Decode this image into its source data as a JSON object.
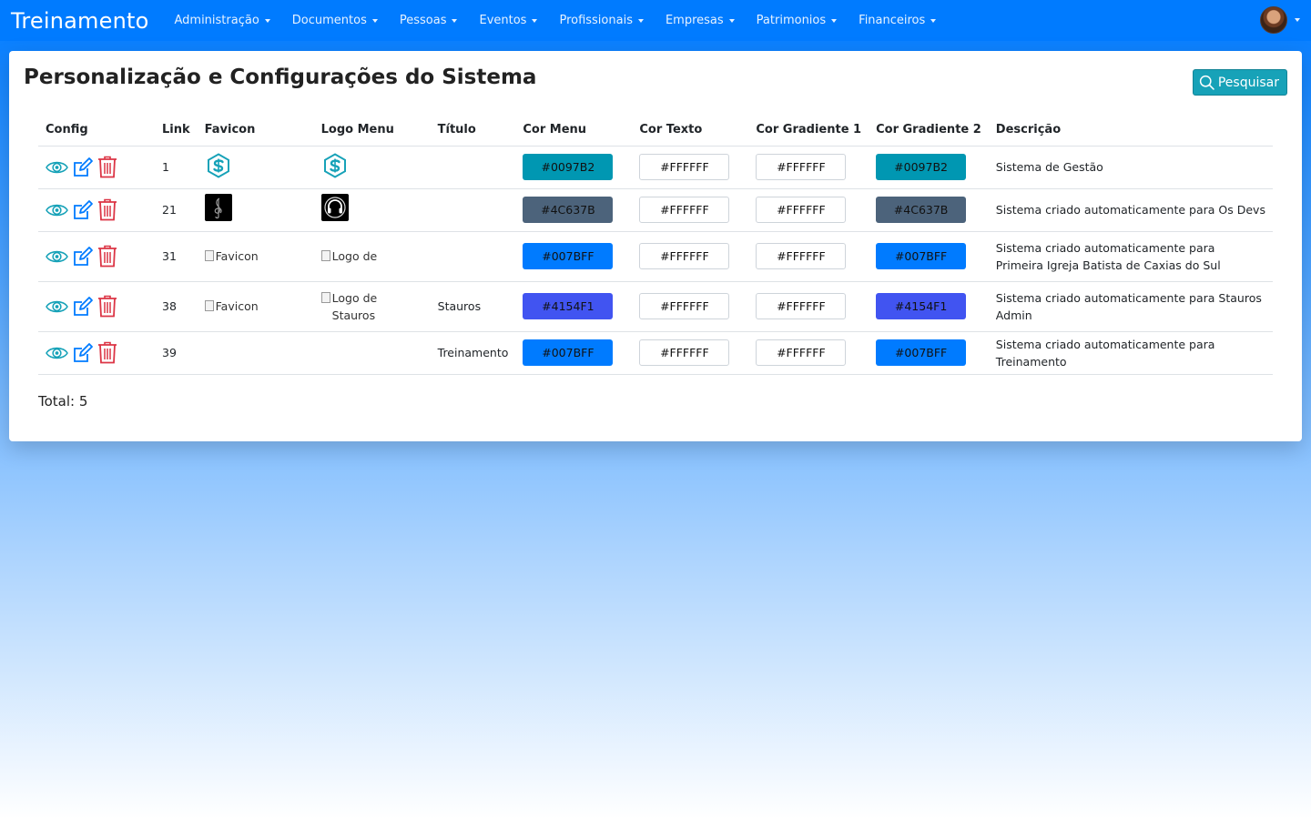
{
  "navbar": {
    "brand": "Treinamento",
    "menu": [
      {
        "label": "Administração"
      },
      {
        "label": "Documentos"
      },
      {
        "label": "Pessoas"
      },
      {
        "label": "Eventos"
      },
      {
        "label": "Profissionais"
      },
      {
        "label": "Empresas"
      },
      {
        "label": "Patrimonios"
      },
      {
        "label": "Financeiros"
      }
    ],
    "user_icon": "avatar"
  },
  "page": {
    "title": "Personalização e Configurações do Sistema",
    "search_label": "Pesquisar",
    "search_icon": "search-icon"
  },
  "table": {
    "headers": {
      "config": "Config",
      "link": "Link",
      "favicon": "Favicon",
      "logo": "Logo Menu",
      "titulo": "Título",
      "cor_menu": "Cor Menu",
      "cor_texto": "Cor Texto",
      "cor_grad1": "Cor Gradiente 1",
      "cor_grad2": "Cor Gradiente 2",
      "descricao": "Descrição"
    },
    "action_icons": [
      "eye-icon",
      "edit-icon",
      "trash-icon"
    ],
    "rows": [
      {
        "link": "1",
        "favicon_type": "s-logo",
        "favicon_alt": "",
        "logo_type": "s-logo",
        "logo_alt": "",
        "titulo": "",
        "cor_menu": "#0097B2",
        "cor_texto": "#FFFFFF",
        "cor_grad1": "#FFFFFF",
        "cor_grad2": "#0097B2",
        "descricao": "Sistema de Gestão"
      },
      {
        "link": "21",
        "favicon_type": "music-note",
        "favicon_alt": "",
        "logo_type": "headphones",
        "logo_alt": "",
        "titulo": "",
        "cor_menu": "#4C637B",
        "cor_texto": "#FFFFFF",
        "cor_grad1": "#FFFFFF",
        "cor_grad2": "#4C637B",
        "descricao": "Sistema criado automaticamente para Os Devs"
      },
      {
        "link": "31",
        "favicon_type": "broken",
        "favicon_alt": "Favicon",
        "logo_type": "broken",
        "logo_alt": "Logo de",
        "titulo": "",
        "cor_menu": "#007BFF",
        "cor_texto": "#FFFFFF",
        "cor_grad1": "#FFFFFF",
        "cor_grad2": "#007BFF",
        "descricao": "Sistema criado automaticamente para Primeira Igreja Batista de Caxias do Sul"
      },
      {
        "link": "38",
        "favicon_type": "broken",
        "favicon_alt": "Favicon",
        "logo_type": "broken",
        "logo_alt": "Logo de Stauros",
        "titulo": "Stauros",
        "cor_menu": "#4154F1",
        "cor_texto": "#FFFFFF",
        "cor_grad1": "#FFFFFF",
        "cor_grad2": "#4154F1",
        "descricao": "Sistema criado automaticamente para Stauros Admin"
      },
      {
        "link": "39",
        "favicon_type": "none",
        "favicon_alt": "",
        "logo_type": "none",
        "logo_alt": "",
        "titulo": "Treinamento",
        "cor_menu": "#007BFF",
        "cor_texto": "#FFFFFF",
        "cor_grad1": "#FFFFFF",
        "cor_grad2": "#007BFF",
        "descricao": "Sistema criado automaticamente para Treinamento"
      }
    ]
  },
  "total_label": "Total: 5"
}
